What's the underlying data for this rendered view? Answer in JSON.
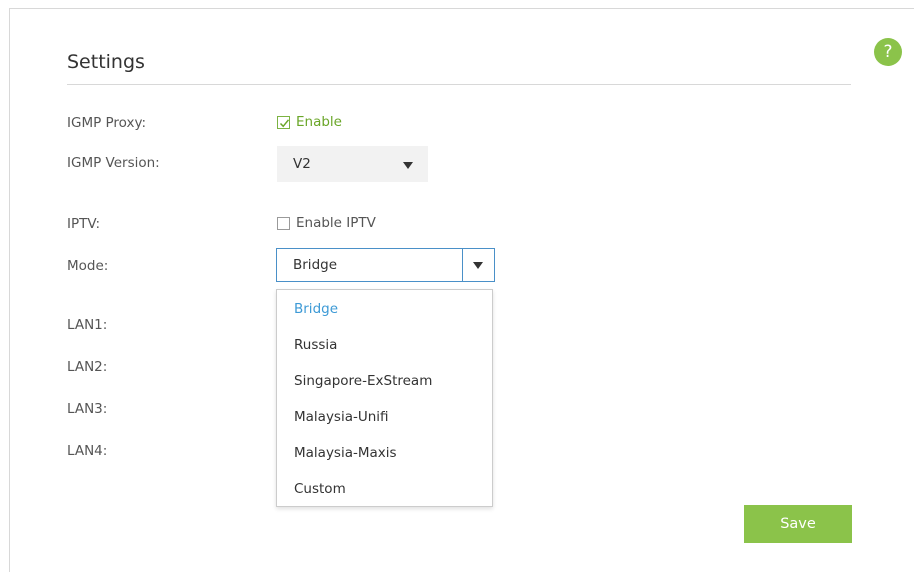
{
  "help": {
    "glyph": "?"
  },
  "settings": {
    "title": "Settings"
  },
  "igmp_proxy": {
    "label": "IGMP Proxy:",
    "checkbox_label": "Enable",
    "checked": true
  },
  "igmp_version": {
    "label": "IGMP Version:",
    "value": "V2"
  },
  "iptv": {
    "label": "IPTV:",
    "checkbox_label": "Enable IPTV",
    "checked": false
  },
  "mode": {
    "label": "Mode:",
    "value": "Bridge",
    "options": [
      "Bridge",
      "Russia",
      "Singapore-ExStream",
      "Malaysia-Unifi",
      "Malaysia-Maxis",
      "Custom"
    ]
  },
  "lan": [
    {
      "label": "LAN1:"
    },
    {
      "label": "LAN2:"
    },
    {
      "label": "LAN3:"
    },
    {
      "label": "LAN4:"
    }
  ],
  "save": {
    "label": "Save"
  },
  "colors": {
    "accent_green": "#8bc34a",
    "check_green": "#6aa628",
    "selected_blue": "#3d9ad6",
    "focus_border": "#4a90c8"
  }
}
